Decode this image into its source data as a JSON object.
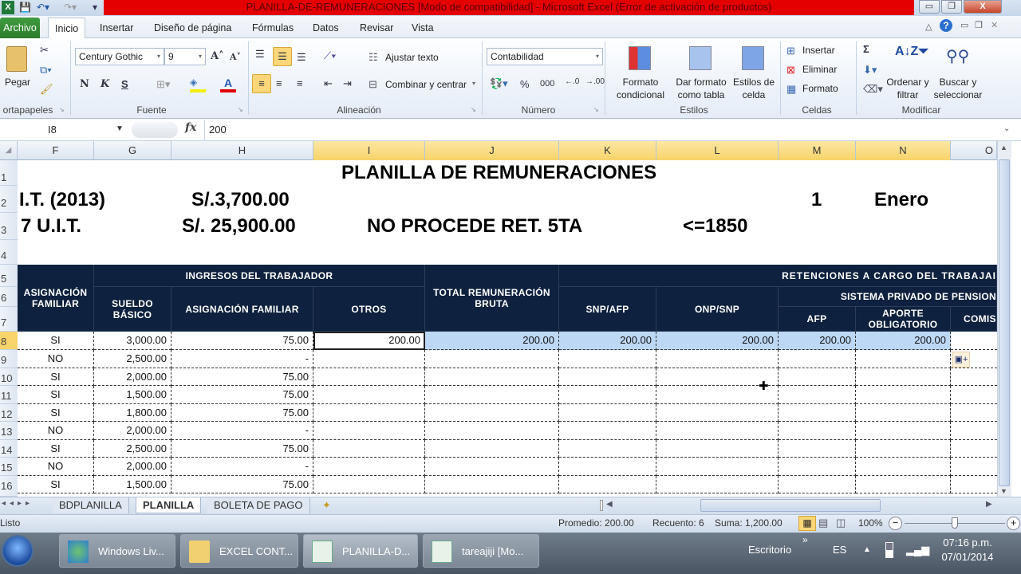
{
  "window": {
    "title": "PLANILLA-DE-REMUNERACIONES  [Modo de compatibilidad]  -  Microsoft Excel (Error de activación de productos)",
    "minimize": "▭",
    "restore": "❐",
    "close": "X"
  },
  "menu": {
    "tabs": [
      "Archivo",
      "Inicio",
      "Insertar",
      "Diseño de página",
      "Fórmulas",
      "Datos",
      "Revisar",
      "Vista"
    ]
  },
  "ribbon": {
    "clipboard": {
      "paste": "Pegar",
      "group": "ortapapeles"
    },
    "font": {
      "name": "Century Gothic",
      "size": "9",
      "bold": "N",
      "italic": "K",
      "underline": "S",
      "group": "Fuente"
    },
    "alignment": {
      "wrap": "Ajustar texto",
      "merge": "Combinar y centrar",
      "group": "Alineación"
    },
    "number": {
      "format": "Contabilidad",
      "percent": "%",
      "thousands": "000",
      "group": "Número"
    },
    "styles": {
      "conditional": "Formato condicional",
      "table": "Dar formato como tabla",
      "cell": "Estilos de celda",
      "group": "Estilos"
    },
    "cells": {
      "insert": "Insertar",
      "delete": "Eliminar",
      "format": "Formato",
      "group": "Celdas"
    },
    "edit": {
      "sum": "Σ",
      "sort": "Ordenar y filtrar",
      "find": "Buscar y seleccionar",
      "group": "Modificar"
    }
  },
  "formula_bar": {
    "cell_ref": "I8",
    "fx": "fx",
    "value": "200"
  },
  "columns": [
    "F",
    "G",
    "H",
    "I",
    "J",
    "K",
    "L",
    "M",
    "N",
    "O"
  ],
  "rows": [
    "1",
    "2",
    "3",
    "4",
    "5",
    "6",
    "7",
    "8",
    "9",
    "10",
    "11",
    "12",
    "13",
    "14",
    "15",
    "16"
  ],
  "sheet": {
    "title": "PLANILLA DE REMUNERACIONES",
    "uit_label": "I.T. (2013)",
    "uit_value": "S/.3,700.00",
    "uit7_label": "7 U.I.T.",
    "uit7_value": "S/. 25,900.00",
    "ret_label": "NO PROCEDE RET. 5TA",
    "ret_cond": "<=1850",
    "month_num": "1",
    "month_name": "Enero"
  },
  "headers": {
    "asig_familiar": "ASIGNACIÓN FAMILIAR",
    "ingresos": "INGRESOS DEL TRABAJADOR",
    "sueldo": "SUELDO BÁSICO",
    "asig_fam2": "ASIGNACIÓN FAMILIAR",
    "otros": "OTROS",
    "total": "TOTAL REMUNERACIÓN BRUTA",
    "retenciones": "RETENCIONES A CARGO DEL TRABAJAI",
    "snp_afp": "SNP/AFP",
    "onp_snp": "ONP/SNP",
    "sistema": "SISTEMA PRIVADO DE PENSION",
    "afp": "AFP",
    "aporte": "APORTE OBLIGATORIO",
    "comis": "COMIS"
  },
  "table_rows": [
    {
      "asig": "SI",
      "sueldo": "3,000.00",
      "asigfam": "75.00",
      "otros": "200.00",
      "total": "200.00",
      "snp": "200.00",
      "onp": "200.00",
      "afp": "200.00",
      "aporte": "200.00"
    },
    {
      "asig": "NO",
      "sueldo": "2,500.00",
      "asigfam": "-",
      "otros": "",
      "total": "",
      "snp": "",
      "onp": "",
      "afp": "",
      "aporte": ""
    },
    {
      "asig": "SI",
      "sueldo": "2,000.00",
      "asigfam": "75.00",
      "otros": "",
      "total": "",
      "snp": "",
      "onp": "",
      "afp": "",
      "aporte": ""
    },
    {
      "asig": "SI",
      "sueldo": "1,500.00",
      "asigfam": "75.00",
      "otros": "",
      "total": "",
      "snp": "",
      "onp": "",
      "afp": "",
      "aporte": ""
    },
    {
      "asig": "SI",
      "sueldo": "1,800.00",
      "asigfam": "75.00",
      "otros": "",
      "total": "",
      "snp": "",
      "onp": "",
      "afp": "",
      "aporte": ""
    },
    {
      "asig": "NO",
      "sueldo": "2,000.00",
      "asigfam": "-",
      "otros": "",
      "total": "",
      "snp": "",
      "onp": "",
      "afp": "",
      "aporte": ""
    },
    {
      "asig": "SI",
      "sueldo": "2,500.00",
      "asigfam": "75.00",
      "otros": "",
      "total": "",
      "snp": "",
      "onp": "",
      "afp": "",
      "aporte": ""
    },
    {
      "asig": "NO",
      "sueldo": "2,000.00",
      "asigfam": "-",
      "otros": "",
      "total": "",
      "snp": "",
      "onp": "",
      "afp": "",
      "aporte": ""
    },
    {
      "asig": "SI",
      "sueldo": "1,500.00",
      "asigfam": "75.00",
      "otros": "",
      "total": "",
      "snp": "",
      "onp": "",
      "afp": "",
      "aporte": ""
    }
  ],
  "sheet_tabs": [
    "BDPLANILLA",
    "PLANILLA",
    "BOLETA DE PAGO"
  ],
  "active_sheet": "PLANILLA",
  "status": {
    "mode": "Listo",
    "average": "Promedio:  200.00",
    "count": "Recuento: 6",
    "sum": "Suma:  1,200.00",
    "zoom": "100%",
    "zoom_level_percent": 100
  },
  "taskbar": {
    "items": [
      "Windows Liv...",
      "EXCEL CONT...",
      "PLANILLA-D...",
      "tareajiji  [Mo..."
    ],
    "desktop": "Escritorio",
    "lang": "ES",
    "time": "07:16 p.m.",
    "date": "07/01/2014"
  },
  "colors": {
    "title_bar": "#e50000",
    "header_fill": "#0e213e",
    "selection": "#bcd8f5",
    "active_header": "#f8d46a",
    "archivo_tab": "#2b7d2b"
  }
}
